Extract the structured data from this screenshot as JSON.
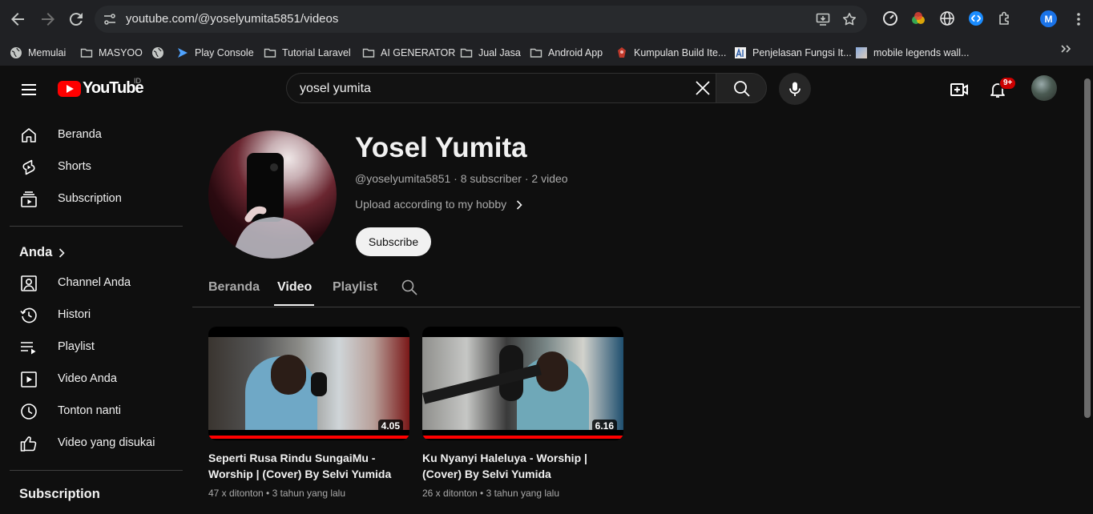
{
  "browser": {
    "url": "youtube.com/@yoselyumita5851/videos",
    "profile_initial": "M",
    "bookmarks": [
      {
        "label": "Memulai",
        "icon": "globe-icon"
      },
      {
        "label": "MASYOO",
        "icon": "folder-icon"
      },
      {
        "label": "",
        "icon": "globe-icon"
      },
      {
        "label": "Play Console",
        "icon": "play-console-icon"
      },
      {
        "label": "Tutorial Laravel",
        "icon": "folder-icon"
      },
      {
        "label": "AI GENERATOR",
        "icon": "folder-icon"
      },
      {
        "label": "Jual Jasa",
        "icon": "folder-icon"
      },
      {
        "label": "Android App",
        "icon": "folder-icon"
      },
      {
        "label": "Kumpulan Build Ite...",
        "icon": "site-favicon-icon"
      },
      {
        "label": "Penjelasan Fungsi It...",
        "icon": "site-favicon-icon"
      },
      {
        "label": "mobile legends wall...",
        "icon": "image-favicon-icon"
      }
    ]
  },
  "masthead": {
    "logo_text": "YouTube",
    "country_code": "ID",
    "search_value": "yosel yumita",
    "notification_count": "9+"
  },
  "sidebar": {
    "main": [
      {
        "label": "Beranda",
        "icon": "home-icon"
      },
      {
        "label": "Shorts",
        "icon": "shorts-icon"
      },
      {
        "label": "Subscription",
        "icon": "subscriptions-icon"
      }
    ],
    "you_heading": "Anda",
    "you": [
      {
        "label": "Channel Anda",
        "icon": "your-channel-icon"
      },
      {
        "label": "Histori",
        "icon": "history-icon"
      },
      {
        "label": "Playlist",
        "icon": "playlist-icon"
      },
      {
        "label": "Video Anda",
        "icon": "your-videos-icon"
      },
      {
        "label": "Tonton nanti",
        "icon": "watch-later-icon"
      },
      {
        "label": "Video yang disukai",
        "icon": "liked-videos-icon"
      }
    ],
    "subscriptions_heading": "Subscription"
  },
  "channel": {
    "name": "Yosel Yumita",
    "meta": "@yoselyumita5851 · 8 subscriber · 2 video",
    "description": "Upload according to my hobby",
    "subscribe_label": "Subscribe",
    "tabs": [
      {
        "label": "Beranda",
        "active": false
      },
      {
        "label": "Video",
        "active": true
      },
      {
        "label": "Playlist",
        "active": false
      }
    ]
  },
  "videos": [
    {
      "title": "Seperti Rusa Rindu SungaiMu - Worship | (Cover) By Selvi Yumida",
      "duration": "4.05",
      "views": "47 x ditonton",
      "age": "3 tahun yang lalu",
      "progress": 1.0
    },
    {
      "title": "Ku Nyanyi Haleluya - Worship | (Cover) By Selvi Yumida",
      "duration": "6.16",
      "views": "26 x ditonton",
      "age": "3 tahun yang lalu",
      "progress": 1.0
    }
  ],
  "colors": {
    "background": "#0f0f0f",
    "text": "#f1f1f1",
    "secondary_text": "#aaaaaa",
    "brand_red": "#ff0000",
    "chrome_bg": "#202124"
  }
}
